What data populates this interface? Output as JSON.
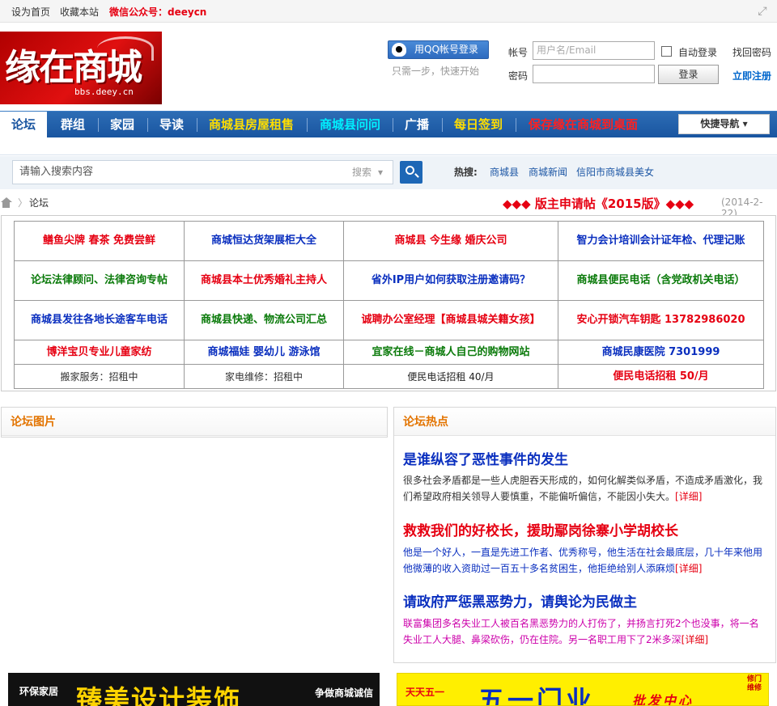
{
  "topbar": {
    "set_home": "设为首页",
    "bookmark": "收藏本站",
    "wechat": "微信公众号：deeycn"
  },
  "logo": {
    "main": "缘在商城",
    "sub": "bbs.deey.cn"
  },
  "login": {
    "qq_button": "用QQ帐号登录",
    "qq_hint": "只需一步，快速开始",
    "account_label": "帐号",
    "account_placeholder": "用户名/Email",
    "password_label": "密码",
    "auto_login": "自动登录",
    "forgot_password": "找回密码",
    "login_button": "登录",
    "register": "立即注册"
  },
  "nav": {
    "items": [
      {
        "label": "论坛"
      },
      {
        "label": "群组"
      },
      {
        "label": "家园"
      },
      {
        "label": "导读"
      },
      {
        "label": "商城县房屋租售"
      },
      {
        "label": "商城县问问"
      },
      {
        "label": "广播"
      },
      {
        "label": "每日签到"
      },
      {
        "label": "保存缘在商城到桌面"
      }
    ],
    "quick_nav": "快捷导航"
  },
  "search": {
    "placeholder": "请输入搜索内容",
    "type": "搜索",
    "hot_label": "热搜:",
    "hot_links": [
      "商城县",
      "商城新闻",
      "信阳市商城县美女"
    ]
  },
  "breadcrumb": {
    "current": "论坛",
    "separator": "〉"
  },
  "announcement": {
    "text": "◆◆◆ 版主申请帖《2015版》◆◆◆",
    "date": "(2014-2-22)"
  },
  "ads": {
    "rows": [
      [
        "鳝鱼尖牌  春茶  免费尝鲜",
        "商城恒达货架展柜大全",
        "商城县  今生缘  婚庆公司",
        "智力会计培训会计证年检、代理记账"
      ],
      [
        "论坛法律顾问、法律咨询专帖",
        "商城县本土优秀婚礼主持人",
        "省外IP用户如何获取注册邀请码？",
        "商城县便民电话（含党政机关电话）"
      ],
      [
        "商城县发往各地长途客车电话",
        "商城县快递、物流公司汇总",
        "诚聘办公室经理【商城县城关籍女孩】",
        "安心开锁汽车钥匙  13782986020"
      ],
      [
        "博洋宝贝专业儿童家纺",
        "商城福娃  婴幼儿  游泳馆",
        "宜家在线－商城人自己的购物网站",
        "商城民康医院  7301999"
      ],
      [
        "搬家服务：招租中",
        "家电维修：招租中",
        "便民电话招租  40/月",
        "便民电话招租  50/月"
      ]
    ]
  },
  "panels": {
    "pictures_title": "论坛图片",
    "hot_title": "论坛热点"
  },
  "hot": [
    {
      "title": "是谁纵容了恶性事件的发生",
      "text": "很多社会矛盾都是一些人虎胆吞天形成的，如何化解类似矛盾，不造成矛盾激化，我们希望政府相关领导人要慎重，不能偏听偏信，不能因小失大。",
      "more": "[详细]"
    },
    {
      "title": "救救我们的好校长，援助鄢岗徐寨小学胡校长",
      "text": "他是一个好人，一直是先进工作者、优秀称号，他生活在社会最底层，几十年来他用他微薄的收入资助过一百五十多名贫困生，他拒绝给别人添麻烦",
      "more": "[详细]"
    },
    {
      "title": "请政府严惩黑恶势力，请舆论为民做主",
      "text": "联富集团多名失业工人被百名黑恶势力的人打伤了，并扬言打死2个也没事，将一名失业工人大腿、鼻梁砍伤，仍在住院。另一名职工用下了2米多深",
      "more": "[详细]"
    }
  ],
  "banners": {
    "left": {
      "a": "环保家居",
      "b": "臻美设计装饰",
      "c": "争做商城诚信"
    },
    "right": {
      "a": "天天五一",
      "b": "五一门业",
      "c": "批发中心",
      "d": "修门维修"
    }
  },
  "colors": {
    "nav_blue": "#1d5fad",
    "accent_red": "#e60012",
    "link_blue": "#0a2fbf",
    "panel_orange": "#e37400"
  }
}
